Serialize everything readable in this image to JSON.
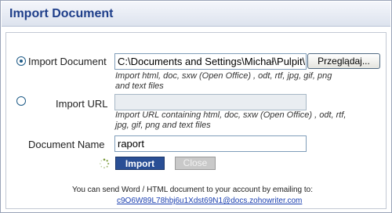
{
  "header": {
    "title": "Import Document"
  },
  "import_document": {
    "label": "Import Document",
    "selected": true,
    "path_value": "C:\\Documents and Settings\\Michał\\Pulpit\\",
    "browse_label": "Przeglądaj...",
    "hint_line1": "Import html, doc, sxw (Open Office) , odt, rtf, jpg, gif, png",
    "hint_line2": "and text files"
  },
  "import_url": {
    "label": "Import URL",
    "selected": false,
    "value": "",
    "hint_line1": "Import URL containing html, doc, sxw (Open Office) , odt, rtf,",
    "hint_line2": "jpg, gif, png and text files"
  },
  "document_name": {
    "label": "Document Name",
    "value": "raport"
  },
  "buttons": {
    "import_label": "Import",
    "close_label": "Close"
  },
  "footer": {
    "text": "You can send Word / HTML document to your account by emailing to:",
    "email": "c9O6W89L78hbj6u1Xdst69N1@docs.zohowriter.com"
  },
  "colors": {
    "title": "#1f3f8a",
    "import_button": "#2a4f95",
    "link": "#1a3fb0"
  }
}
